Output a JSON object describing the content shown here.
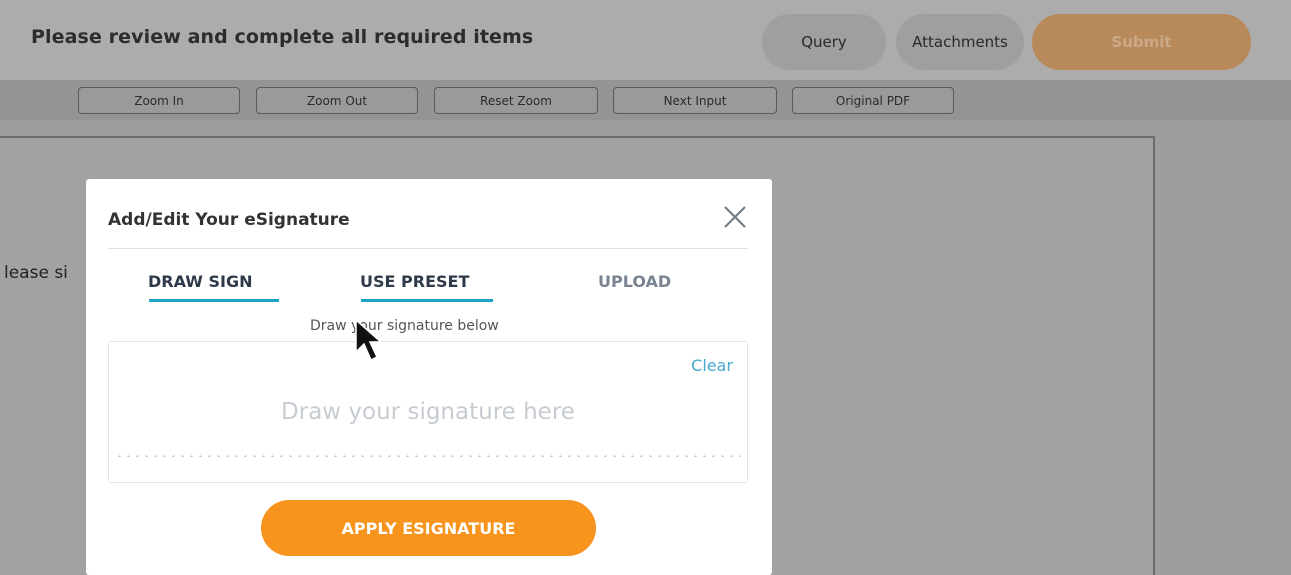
{
  "header": {
    "title": "Please review and complete all required items",
    "query_label": "Query",
    "attachments_label": "Attachments",
    "submit_label": "Submit"
  },
  "toolbar": {
    "buttons": [
      "Zoom In",
      "Zoom Out",
      "Reset Zoom",
      "Next Input",
      "Original PDF"
    ]
  },
  "document": {
    "text": "lease si"
  },
  "modal": {
    "title": "Add/Edit Your eSignature",
    "tabs": [
      "DRAW SIGN",
      "USE PRESET",
      "UPLOAD"
    ],
    "instruction": "Draw your signature below",
    "clear_label": "Clear",
    "placeholder": "Draw your signature here",
    "apply_label": "APPLY ESIGNATURE"
  },
  "colors": {
    "accent_orange": "#f7941d",
    "tab_underline": "#1fa3c9",
    "link_blue": "#45a9cf"
  },
  "icons": {
    "close": "close-icon",
    "cursor": "mouse-pointer-icon"
  }
}
